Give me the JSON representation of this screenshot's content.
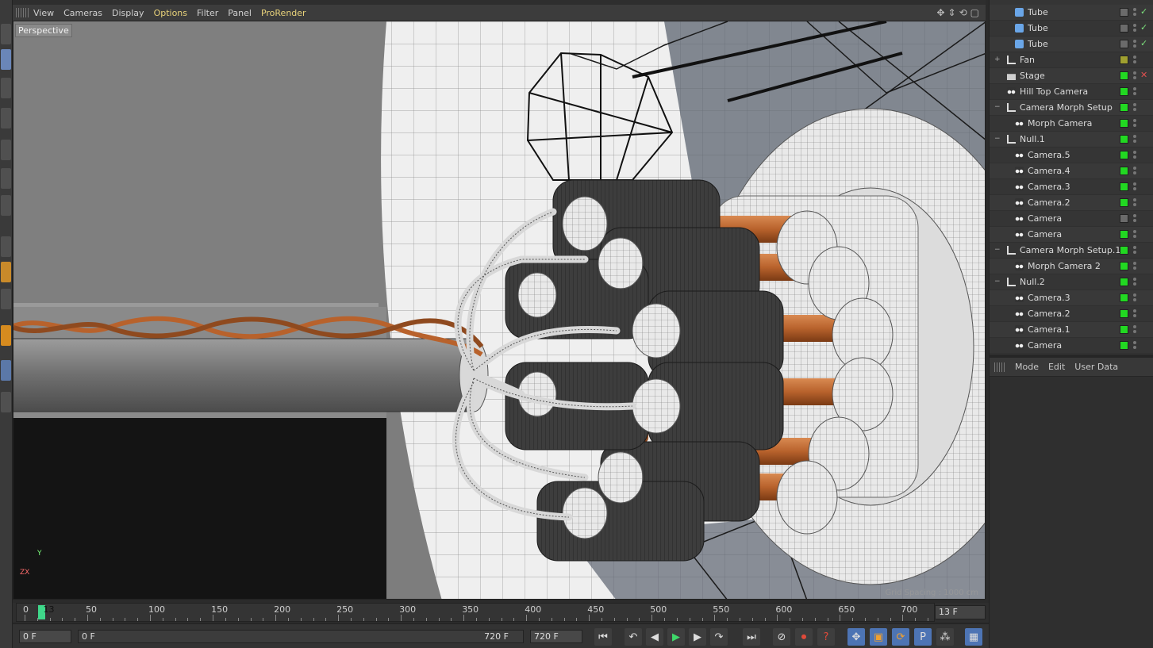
{
  "viewport_menu": {
    "items": [
      {
        "label": "View",
        "highlight": false
      },
      {
        "label": "Cameras",
        "highlight": false
      },
      {
        "label": "Display",
        "highlight": false
      },
      {
        "label": "Options",
        "highlight": true
      },
      {
        "label": "Filter",
        "highlight": false
      },
      {
        "label": "Panel",
        "highlight": false
      },
      {
        "label": "ProRender",
        "highlight": true
      }
    ],
    "nav_icons": [
      "move-view-icon",
      "zoom-view-icon",
      "rotate-view-icon",
      "maximize-view-icon"
    ]
  },
  "viewport": {
    "label": "Perspective",
    "grid_spacing": "Grid Spacing : 1000 cm",
    "axis_y": "Y",
    "axis_zx": "ZX"
  },
  "object_manager": {
    "rows": [
      {
        "label": "Tube",
        "depth": 2,
        "icon": "tube-icon",
        "expand": "",
        "vis": "#6b6b6b",
        "tag": "✓",
        "tag_color": "#7ce07c"
      },
      {
        "label": "Tube",
        "depth": 2,
        "icon": "tube-icon",
        "expand": "",
        "vis": "#6b6b6b",
        "tag": "✓",
        "tag_color": "#7ce07c"
      },
      {
        "label": "Tube",
        "depth": 2,
        "icon": "tube-icon",
        "expand": "",
        "vis": "#6b6b6b",
        "tag": "✓",
        "tag_color": "#7ce07c"
      },
      {
        "label": "Fan",
        "depth": 1,
        "icon": "null-icon",
        "expand": "+",
        "vis": "#a0a030",
        "tag": "",
        "tag_color": ""
      },
      {
        "label": "Stage",
        "depth": 1,
        "icon": "stage-icon",
        "expand": "",
        "vis": "#22d822",
        "tag": "✕",
        "tag_color": "#e05050"
      },
      {
        "label": "Hill Top Camera",
        "depth": 1,
        "icon": "camera-icon",
        "expand": "",
        "vis": "#22d822",
        "tag": "",
        "tag_color": ""
      },
      {
        "label": "Camera Morph Setup",
        "depth": 1,
        "icon": "null-icon",
        "expand": "−",
        "vis": "#22d822",
        "tag": "",
        "tag_color": ""
      },
      {
        "label": "Morph Camera",
        "depth": 2,
        "icon": "camera-icon",
        "expand": "",
        "vis": "#22d822",
        "tag": "",
        "tag_color": ""
      },
      {
        "label": "Null.1",
        "depth": 1,
        "icon": "null-icon",
        "expand": "−",
        "vis": "#22d822",
        "tag": "",
        "tag_color": ""
      },
      {
        "label": "Camera.5",
        "depth": 2,
        "icon": "camera-icon",
        "expand": "",
        "vis": "#22d822",
        "tag": "",
        "tag_color": ""
      },
      {
        "label": "Camera.4",
        "depth": 2,
        "icon": "camera-icon",
        "expand": "",
        "vis": "#22d822",
        "tag": "",
        "tag_color": ""
      },
      {
        "label": "Camera.3",
        "depth": 2,
        "icon": "camera-icon",
        "expand": "",
        "vis": "#22d822",
        "tag": "",
        "tag_color": ""
      },
      {
        "label": "Camera.2",
        "depth": 2,
        "icon": "camera-icon",
        "expand": "",
        "vis": "#22d822",
        "tag": "",
        "tag_color": ""
      },
      {
        "label": "Camera",
        "depth": 2,
        "icon": "camera-icon",
        "expand": "",
        "vis": "#6b6b6b",
        "tag": "",
        "tag_color": ""
      },
      {
        "label": "Camera",
        "depth": 2,
        "icon": "camera-icon",
        "expand": "",
        "vis": "#22d822",
        "tag": "",
        "tag_color": ""
      },
      {
        "label": "Camera Morph Setup.1",
        "depth": 1,
        "icon": "null-icon",
        "expand": "−",
        "vis": "#22d822",
        "tag": "",
        "tag_color": ""
      },
      {
        "label": "Morph Camera 2",
        "depth": 2,
        "icon": "camera-icon",
        "expand": "",
        "vis": "#22d822",
        "tag": "",
        "tag_color": ""
      },
      {
        "label": "Null.2",
        "depth": 1,
        "icon": "null-icon",
        "expand": "−",
        "vis": "#22d822",
        "tag": "",
        "tag_color": ""
      },
      {
        "label": "Camera.3",
        "depth": 2,
        "icon": "camera-icon",
        "expand": "",
        "vis": "#22d822",
        "tag": "",
        "tag_color": ""
      },
      {
        "label": "Camera.2",
        "depth": 2,
        "icon": "camera-icon",
        "expand": "",
        "vis": "#22d822",
        "tag": "",
        "tag_color": ""
      },
      {
        "label": "Camera.1",
        "depth": 2,
        "icon": "camera-icon",
        "expand": "",
        "vis": "#22d822",
        "tag": "",
        "tag_color": ""
      },
      {
        "label": "Camera",
        "depth": 2,
        "icon": "camera-icon",
        "expand": "",
        "vis": "#22d822",
        "tag": "",
        "tag_color": ""
      }
    ]
  },
  "attribute_manager": {
    "menu": [
      "Mode",
      "Edit",
      "User Data"
    ]
  },
  "timeline": {
    "labels": [
      "0",
      "13",
      "50",
      "100",
      "150",
      "200",
      "250",
      "300",
      "350",
      "400",
      "450",
      "500",
      "550",
      "600",
      "650",
      "700"
    ],
    "tick_frames": [
      0,
      50,
      100,
      150,
      200,
      250,
      300,
      350,
      400,
      450,
      500,
      550,
      600,
      650,
      700
    ],
    "current_frame": 13,
    "max_frame": 720,
    "current_frame_display": "13 F"
  },
  "transport": {
    "start_field": "0 F",
    "range_start": "0 F",
    "range_end": "720 F",
    "end_field": "720 F",
    "buttons": [
      {
        "name": "go-to-start-icon",
        "glyph": "⏮",
        "active": false
      },
      {
        "name": "previous-key-icon",
        "glyph": "↶",
        "active": false
      },
      {
        "name": "previous-frame-icon",
        "glyph": "◀",
        "active": false
      },
      {
        "name": "play-icon",
        "glyph": "▶",
        "active": false
      },
      {
        "name": "next-frame-icon",
        "glyph": "▶",
        "active": false
      },
      {
        "name": "next-key-icon",
        "glyph": "↷",
        "active": false
      },
      {
        "name": "go-to-end-icon",
        "glyph": "⏭",
        "active": false
      },
      {
        "name": "record-disabled-icon",
        "glyph": "⊘",
        "active": false
      },
      {
        "name": "record-keys-icon",
        "glyph": "⏺",
        "active": false
      },
      {
        "name": "autokey-icon",
        "glyph": "?",
        "active": false
      },
      {
        "name": "key-position-icon",
        "glyph": "✥",
        "active": true
      },
      {
        "name": "key-scale-icon",
        "glyph": "▣",
        "active": true
      },
      {
        "name": "key-rotation-icon",
        "glyph": "⟳",
        "active": true
      },
      {
        "name": "key-parameter-icon",
        "glyph": "P",
        "active": true
      },
      {
        "name": "key-pla-icon",
        "glyph": "⁂",
        "active": false
      },
      {
        "name": "timeline-film-icon",
        "glyph": "▦",
        "active": true
      }
    ]
  },
  "colors": {
    "accent_blue": "#4d74b4",
    "visible_green": "#22d822",
    "menu_highlight": "#e8d27a",
    "copper": "#b8622c"
  }
}
